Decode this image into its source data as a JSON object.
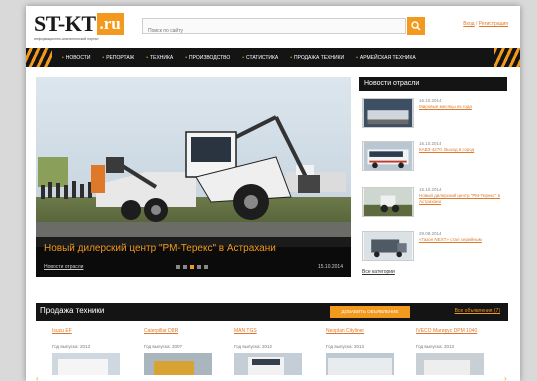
{
  "header": {
    "logo_main": "ST-KT",
    "logo_suffix": ".ru",
    "logo_tagline": "информационно-аналитический портал",
    "search_placeholder": "Поиск по сайту",
    "login": "Вход",
    "auth_sep": "/",
    "register": "Регистрация"
  },
  "nav": {
    "items": [
      "НОВОСТИ",
      "РЕПОРТАЖ",
      "ТЕХНИКА",
      "ПРОИЗВОДСТВО",
      "СТАТИСТИКА",
      "ПРОДАЖА ТЕХНИКИ",
      "АРМЕЙСКАЯ ТЕХНИКА"
    ]
  },
  "hero": {
    "title": "Новый дилерский центр \"РМ-Терекс\" в Астрахани",
    "category_link": "Новости отрасли",
    "date": "15.10.2014",
    "slide_count": 5,
    "active_slide": 3
  },
  "news": {
    "heading": "Новости отрасли",
    "items": [
      {
        "date": "16.10.2014",
        "text": "Мировые месяцы из года"
      },
      {
        "date": "16.10.2014",
        "text": "КАВЗ-4270. Выход в город"
      },
      {
        "date": "15.10.2014",
        "text": "Новый дилерский центр \"РМ-Терекс\" в Астрахани"
      },
      {
        "date": "29.09.2014",
        "text": "«Газон NEXT» стал серийным"
      }
    ],
    "all_link": "Все категории"
  },
  "sales": {
    "heading": "Продажа техники",
    "add_button": "ДОБАВИТЬ ОБЪЯВЛЕНИЕ",
    "all_link": "Все объявления (7)",
    "cars": [
      {
        "name": "Isuzu EF",
        "year": "Год выпуска: 2013"
      },
      {
        "name": "Caterpillar D8R",
        "year": "Год выпуска: 2007"
      },
      {
        "name": "MAN TGS",
        "year": "Год выпуска: 2012"
      },
      {
        "name": "Neoplan Cityliner",
        "year": "Год выпуска: 2013"
      },
      {
        "name": "IVECO Магирус DPM 1040",
        "year": "Год выпуска: 2013"
      }
    ]
  },
  "colors": {
    "accent": "#f39a1e",
    "dark": "#141414"
  }
}
